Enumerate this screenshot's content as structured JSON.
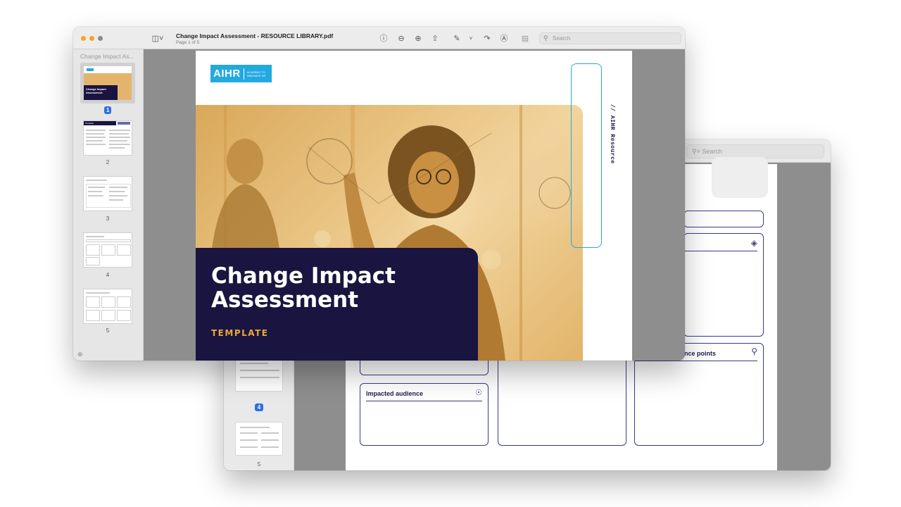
{
  "back_window": {
    "search_placeholder": "Search",
    "thumbnails": [
      {
        "number": "4",
        "selected": true
      },
      {
        "number": "5",
        "selected": false
      }
    ],
    "boxes": {
      "impacted_audience": "Impacted audience",
      "resistance_points": "tance points"
    }
  },
  "front_window": {
    "doc_title": "Change Impact Assessment - RESOURCE LIBRARY.pdf",
    "doc_subtitle": "Page 1 of 5",
    "search_placeholder": "Search",
    "sidebar_title": "Change Impact As...",
    "thumbnails": [
      {
        "number": "1",
        "selected": true,
        "cover_title": "Change Impact Assessment"
      },
      {
        "number": "2",
        "selected": false,
        "header": "Template"
      },
      {
        "number": "3",
        "selected": false
      },
      {
        "number": "4",
        "selected": false
      },
      {
        "number": "5",
        "selected": false
      }
    ],
    "page": {
      "logo_main": "AIHR",
      "logo_small": "ACADEMY TO INNOVATE HR",
      "side_label": "// AIHR Resource",
      "title": "Change Impact Assessment",
      "subtitle": "TEMPLATE"
    }
  },
  "colors": {
    "navy": "#1a1440",
    "gold": "#e8a93a",
    "cyan": "#22a9e0",
    "selection_blue": "#2f6fe0"
  }
}
